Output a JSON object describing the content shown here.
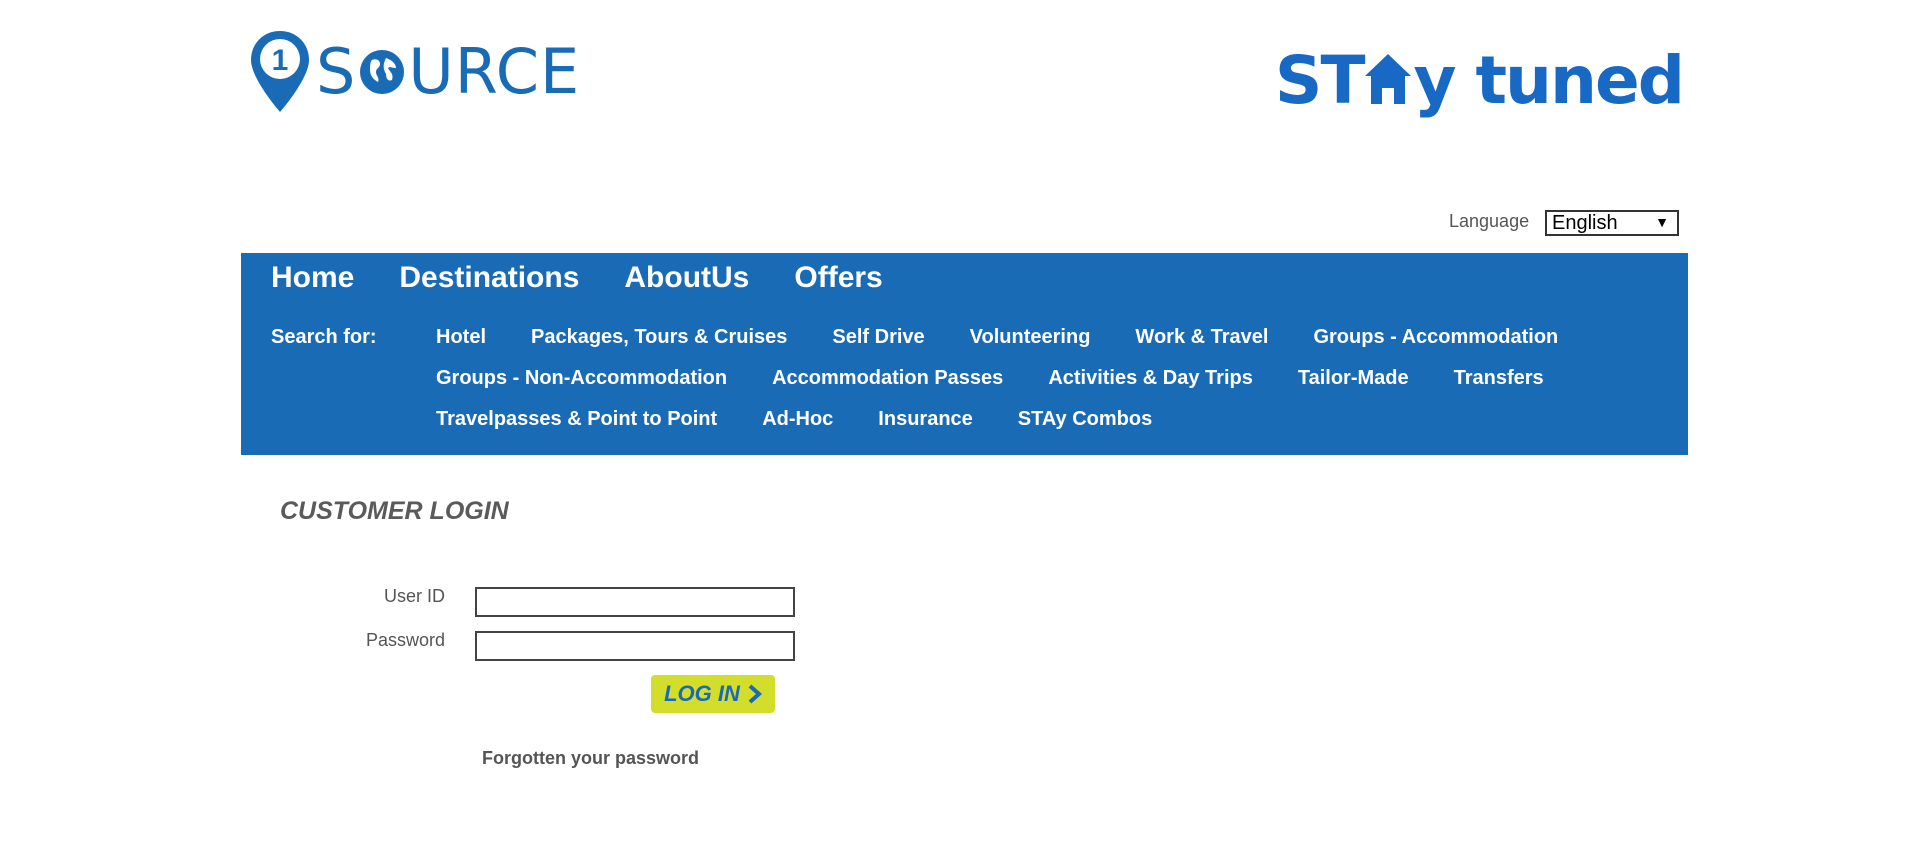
{
  "logos": {
    "left_text": "S URCE",
    "left_text_first": "S",
    "left_text_rest": "URCE",
    "left_badge_number": "1",
    "right_text_first": "ST",
    "right_text_rest": "y tuned"
  },
  "language": {
    "label": "Language",
    "selected": "English"
  },
  "nav": {
    "main": [
      "Home",
      "Destinations",
      "AboutUs",
      "Offers"
    ],
    "search_label": "Search for:",
    "search_rows": [
      [
        "Hotel",
        "Packages, Tours & Cruises",
        "Self Drive",
        "Volunteering",
        "Work & Travel",
        "Groups - Accommodation"
      ],
      [
        "Groups - Non-Accommodation",
        "Accommodation Passes",
        "Activities & Day Trips",
        "Tailor-Made",
        "Transfers"
      ],
      [
        "Travelpasses & Point to Point",
        "Ad-Hoc",
        "Insurance",
        "STAy Combos"
      ]
    ]
  },
  "login": {
    "title": "CUSTOMER LOGIN",
    "user_id_label": "User ID",
    "password_label": "Password",
    "user_id_value": "",
    "password_value": "",
    "button_label": "LOG IN",
    "forgot_label": "Forgotten your password"
  },
  "colors": {
    "brand_blue": "#1a6bb5",
    "button_yellow": "#d3dd2b",
    "text_gray": "#555555"
  }
}
